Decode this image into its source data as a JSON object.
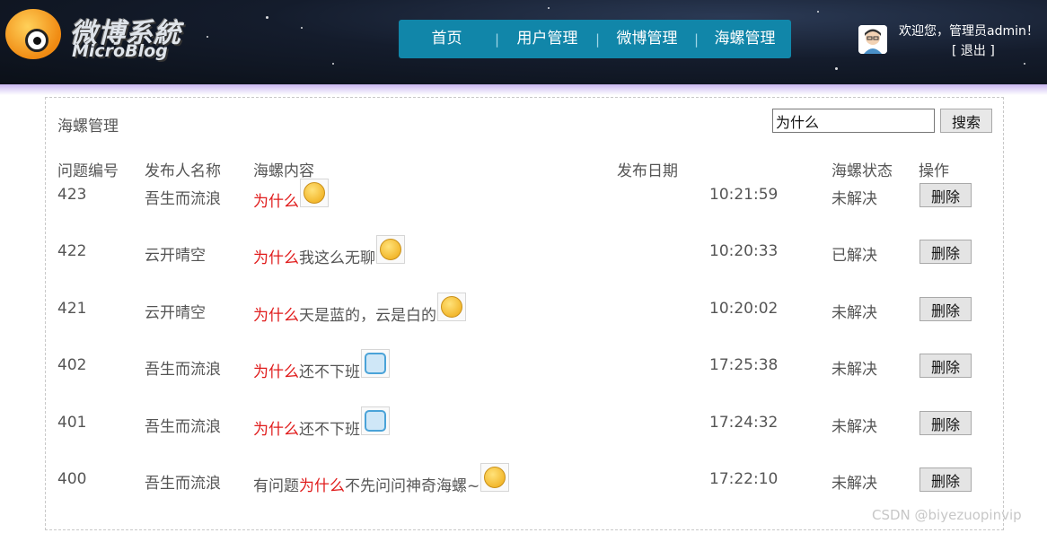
{
  "header": {
    "logo_cn": "微博系統",
    "logo_en": "MicroBlog",
    "nav": [
      {
        "label": "首页"
      },
      {
        "label": "用户管理"
      },
      {
        "label": "微博管理"
      },
      {
        "label": "海螺管理"
      }
    ],
    "welcome_text": "欢迎您，管理员admin！",
    "logout_label": "[ 退出 ]"
  },
  "panel": {
    "title": "海螺管理",
    "search_value": "为什么",
    "search_button": "搜索",
    "columns": [
      "问题编号",
      "发布人名称",
      "海螺内容",
      "发布日期",
      "海螺状态",
      "操作"
    ]
  },
  "rows": [
    {
      "id": "423",
      "author": "吾生而流浪",
      "prefix": "",
      "keyword": "为什么",
      "suffix": "",
      "time": "10:21:59",
      "status": "未解决",
      "action": "删除",
      "emoji": "grimace-emoji-icon"
    },
    {
      "id": "422",
      "author": "云开晴空",
      "prefix": "",
      "keyword": "为什么",
      "suffix": "我这么无聊",
      "time": "10:20:33",
      "status": "已解决",
      "action": "删除",
      "emoji": "surprised-emoji-icon"
    },
    {
      "id": "421",
      "author": "云开晴空",
      "prefix": "",
      "keyword": "为什么",
      "suffix": "天是蓝的，云是白的",
      "time": "10:20:02",
      "status": "未解决",
      "action": "删除",
      "emoji": "pondering-emoji-icon"
    },
    {
      "id": "402",
      "author": "吾生而流浪",
      "prefix": "",
      "keyword": "为什么",
      "suffix": "还不下班",
      "time": "17:25:38",
      "status": "未解决",
      "action": "删除",
      "emoji": "office-emoji-icon"
    },
    {
      "id": "401",
      "author": "吾生而流浪",
      "prefix": "",
      "keyword": "为什么",
      "suffix": "还不下班",
      "time": "17:24:32",
      "status": "未解决",
      "action": "删除",
      "emoji": "office-emoji-icon"
    },
    {
      "id": "400",
      "author": "吾生而流浪",
      "prefix": "有问题",
      "keyword": "为什么",
      "suffix": "不先问问神奇海螺~",
      "time": "17:22:10",
      "status": "未解决",
      "action": "删除",
      "emoji": "sly-emoji-icon"
    }
  ],
  "watermark": "CSDN @biyezuopinvip",
  "colors": {
    "nav_bg": "#1186a9",
    "keyword": "#e01b1b",
    "header_bg": "#141c2c"
  }
}
